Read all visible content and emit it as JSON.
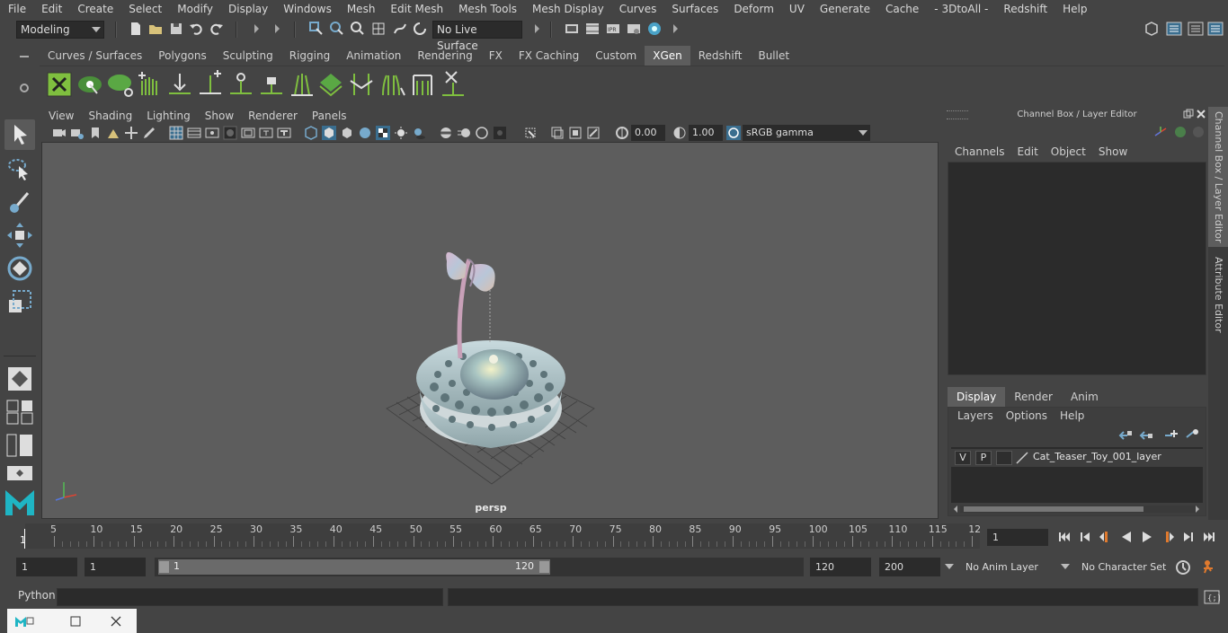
{
  "menu": [
    "File",
    "Edit",
    "Create",
    "Select",
    "Modify",
    "Display",
    "Windows",
    "Mesh",
    "Edit Mesh",
    "Mesh Tools",
    "Mesh Display",
    "Curves",
    "Surfaces",
    "Deform",
    "UV",
    "Generate",
    "Cache",
    "- 3DtoAll -",
    "Redshift",
    "Help"
  ],
  "status": {
    "mode": "Modeling",
    "live_surface": "No Live Surface"
  },
  "shelf_tabs": [
    "Curves / Surfaces",
    "Polygons",
    "Sculpting",
    "Rigging",
    "Animation",
    "Rendering",
    "FX",
    "FX Caching",
    "Custom",
    "XGen",
    "Redshift",
    "Bullet"
  ],
  "shelf_active": "XGen",
  "viewport": {
    "menu": [
      "View",
      "Shading",
      "Lighting",
      "Show",
      "Renderer",
      "Panels"
    ],
    "exposure": "0.00",
    "gamma": "1.00",
    "color_space": "sRGB gamma",
    "camera_label": "persp"
  },
  "right_panel": {
    "title": "Channel Box / Layer Editor",
    "menu": [
      "Channels",
      "Edit",
      "Object",
      "Show"
    ],
    "layer_tabs": [
      "Display",
      "Render",
      "Anim"
    ],
    "layer_menu": [
      "Layers",
      "Options",
      "Help"
    ],
    "layer": {
      "v": "V",
      "p": "P",
      "name": "Cat_Teaser_Toy_001_layer"
    },
    "side_tabs": [
      "Channel Box / Layer Editor",
      "Attribute Editor"
    ]
  },
  "timeline": {
    "ticks": [
      "5",
      "10",
      "15",
      "20",
      "25",
      "30",
      "35",
      "40",
      "45",
      "50",
      "55",
      "60",
      "65",
      "70",
      "75",
      "80",
      "85",
      "90",
      "95",
      "100",
      "105",
      "110",
      "115",
      "12"
    ],
    "start_marker": "1",
    "current_frame": "1"
  },
  "range": {
    "start": "1",
    "playback_start": "1",
    "handle_start": "1",
    "handle_end": "120",
    "playback_end": "120",
    "end": "200",
    "anim_layer": "No Anim Layer",
    "character_set": "No Character Set"
  },
  "command": {
    "label": "Python"
  }
}
